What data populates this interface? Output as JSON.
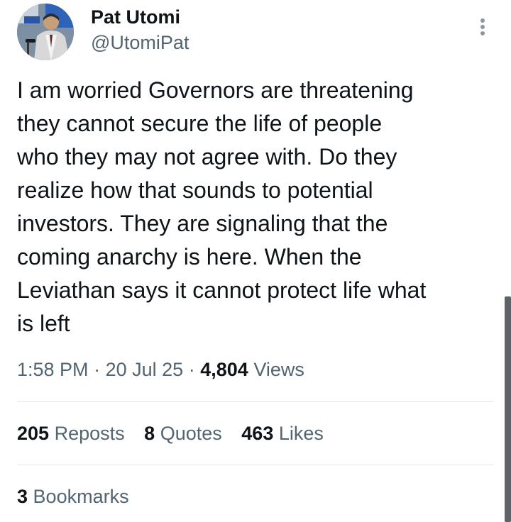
{
  "author": {
    "display_name": "Pat Utomi",
    "handle": "@UtomiPat"
  },
  "icons": {
    "more": "more-vertical-icon",
    "avatar": "avatar-photo"
  },
  "tweet": {
    "text": "I am worried Governors are threatening\nthey cannot secure the life of people\nwho they may not agree with. Do they\nrealize how that sounds to potential\ninvestors. They are signaling that the\ncoming anarchy is here. When the\nLeviathan says it cannot protect life what\nis left"
  },
  "meta": {
    "time": "1:58 PM",
    "separator": "·",
    "date": "20 Jul 25",
    "views_count": "4,804",
    "views_label": "Views"
  },
  "stats": {
    "reposts_count": "205",
    "reposts_label": "Reposts",
    "quotes_count": "8",
    "quotes_label": "Quotes",
    "likes_count": "463",
    "likes_label": "Likes",
    "bookmarks_count": "3",
    "bookmarks_label": "Bookmarks"
  },
  "colors": {
    "text": "#0f1419",
    "secondary": "#536471",
    "divider": "#e1e6ea"
  }
}
